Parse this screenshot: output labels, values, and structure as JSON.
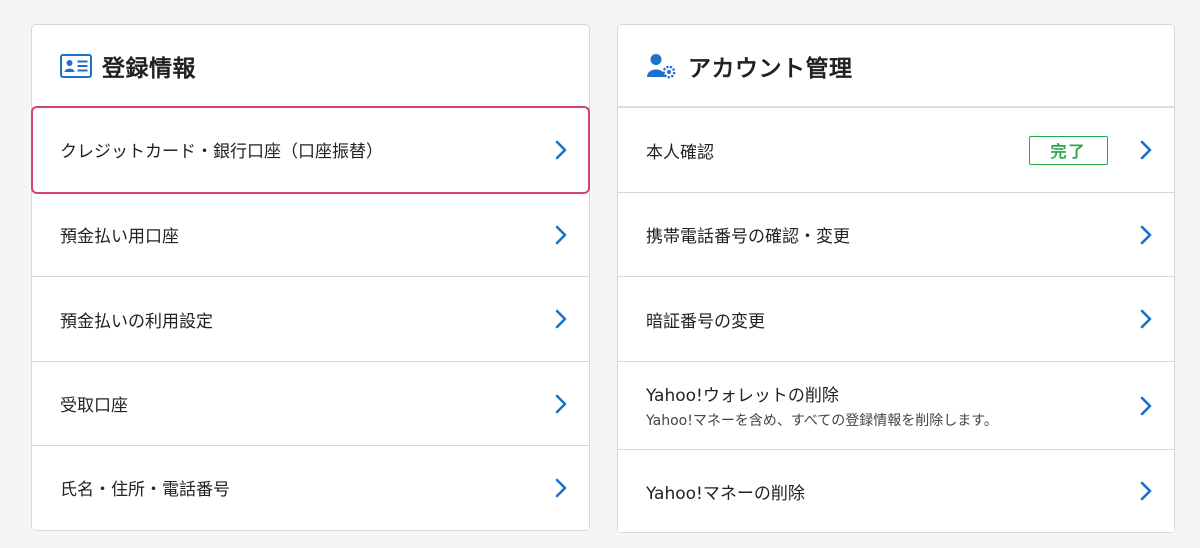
{
  "left_panel": {
    "title": "登録情報",
    "header_icon": "id-card-icon",
    "items": [
      {
        "label": "クレジットカード・銀行口座（口座振替）"
      },
      {
        "label": "預金払い用口座"
      },
      {
        "label": "預金払いの利用設定"
      },
      {
        "label": "受取口座"
      },
      {
        "label": "氏名・住所・電話番号"
      }
    ]
  },
  "right_panel": {
    "title": "アカウント管理",
    "header_icon": "user-gear-icon",
    "items": [
      {
        "label": "本人確認",
        "badge": "完了"
      },
      {
        "label": "携帯電話番号の確認・変更"
      },
      {
        "label": "暗証番号の変更"
      },
      {
        "label": "Yahoo!ウォレットの削除",
        "sublabel": "Yahoo!マネーを含め、すべての登録情報を削除します。"
      },
      {
        "label": "Yahoo!マネーの削除"
      }
    ]
  },
  "colors": {
    "accent_blue": "#1a73c8",
    "highlight_border": "#d9407b",
    "badge_green": "#28a745"
  },
  "icons": {
    "row_arrow": "chevron-right-icon"
  }
}
